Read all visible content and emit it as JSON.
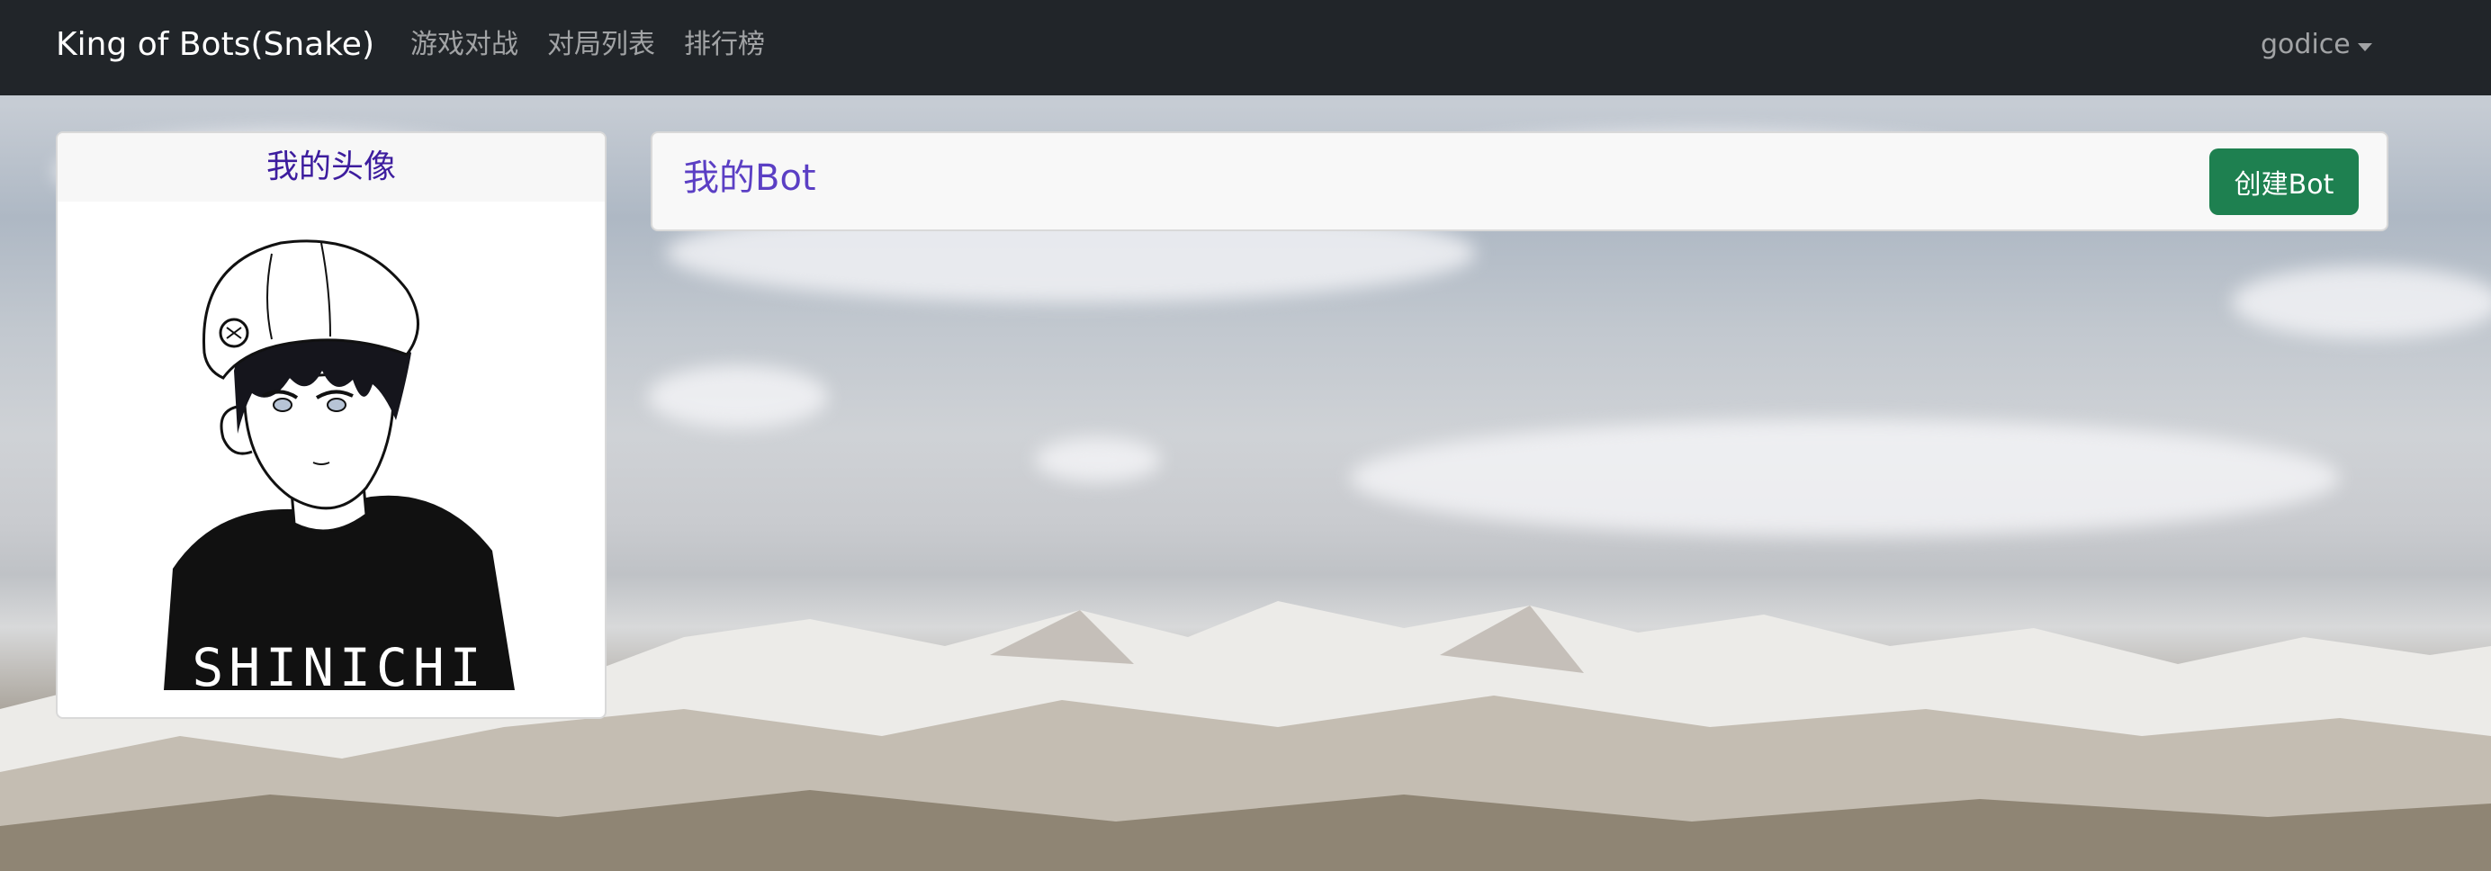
{
  "navbar": {
    "brand": "King of Bots(Snake)",
    "links": [
      "游戏对战",
      "对局列表",
      "排行榜"
    ],
    "user": "godice"
  },
  "avatar_card": {
    "title": "我的头像",
    "shirt_text": "SHINICHI"
  },
  "bot_card": {
    "title": "我的Bot",
    "create_button": "创建Bot"
  },
  "colors": {
    "navbar_bg": "#212529",
    "accent_title": "#3d1d9e",
    "create_button": "#1e8050"
  }
}
